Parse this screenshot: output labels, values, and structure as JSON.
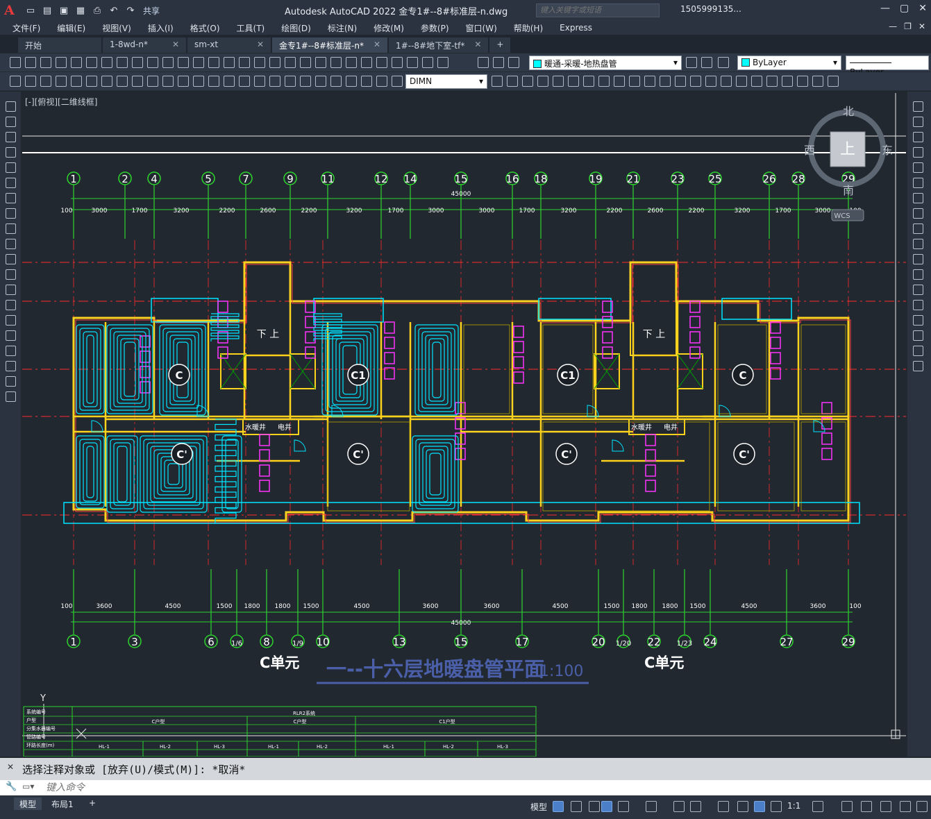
{
  "app": {
    "title": "Autodesk AutoCAD 2022    金专1#--8#标准层-n.dwg",
    "share_label": "共享",
    "search_placeholder": "键入关键字或短语",
    "user": "1505999135..."
  },
  "menu": [
    "文件(F)",
    "编辑(E)",
    "视图(V)",
    "插入(I)",
    "格式(O)",
    "工具(T)",
    "绘图(D)",
    "标注(N)",
    "修改(M)",
    "参数(P)",
    "窗口(W)",
    "帮助(H)",
    "Express"
  ],
  "tabs": [
    {
      "label": "开始"
    },
    {
      "label": "1-8wd-n*"
    },
    {
      "label": "sm-xt"
    },
    {
      "label": "金专1#--8#标准层-n*"
    },
    {
      "label": "1#--8#地下室-tf*"
    }
  ],
  "toolbar": {
    "layer": "暖通-采暖-地热盘管",
    "color": "ByLayer",
    "linetype": "ByLayer",
    "dimstyle": "DIMN"
  },
  "viewport": {
    "label": "[-][俯视][二维线框]",
    "compass": {
      "north": "北",
      "south": "南",
      "east": "东",
      "west": "西",
      "center": "上",
      "wcs": "WCS"
    }
  },
  "drawing": {
    "top_axes": [
      "1",
      "2",
      "4",
      "5",
      "7",
      "9",
      "11",
      "12",
      "14",
      "15",
      "16",
      "18",
      "19",
      "21",
      "23",
      "25",
      "26",
      "28",
      "29"
    ],
    "bottom_axes": [
      "1",
      "3",
      "6",
      "1/6",
      "8",
      "1/9",
      "10",
      "13",
      "15",
      "17",
      "20",
      "1/20",
      "22",
      "1/23",
      "24",
      "27",
      "29"
    ],
    "top_dims": [
      "100",
      "3000",
      "1700",
      "3200",
      "2200",
      "2600",
      "2200",
      "3200",
      "1700",
      "3000",
      "3000",
      "1700",
      "3200",
      "2200",
      "2600",
      "2200",
      "3200",
      "1700",
      "3000",
      "100"
    ],
    "bottom_dims": [
      "100",
      "3600",
      "4500",
      "1500",
      "1800",
      "1800",
      "1500",
      "4500",
      "3600",
      "3600",
      "4500",
      "1500",
      "1800",
      "1800",
      "1500",
      "4500",
      "3600",
      "100"
    ],
    "overall_dim": "45000",
    "unit_labels": [
      "C单元",
      "C单元"
    ],
    "title": "一--十六层地暖盘管平面",
    "scale": "1:100",
    "room_tags": [
      "C",
      "C1",
      "C1",
      "C",
      "C'",
      "C'",
      "C'",
      "C'",
      "C'",
      "C'"
    ],
    "labels": {
      "stairs": "下 上",
      "water": "水暖井",
      "elec": "电井"
    },
    "table_headers": [
      "系统编号",
      "户型",
      "分集水器编号",
      "管路编号",
      "环路长度(m)"
    ],
    "table_groups": [
      "RLR2系统",
      "C户型",
      "C户型",
      "C1户型"
    ],
    "table_loops": [
      "HL-1",
      "HL-2",
      "HL-3",
      "HL-1",
      "HL-2",
      "HL-1",
      "HL-2",
      "HL-3"
    ]
  },
  "command": {
    "history": "选择注释对象或 [放弃(U)/模式(M)]: *取消*",
    "placeholder": "键入命令"
  },
  "status": {
    "layout_tabs": [
      "模型",
      "布局1"
    ],
    "model_label": "模型",
    "scale": "1:1"
  },
  "colors": {
    "axis": "#2ed52e",
    "wall": "#ffd21e",
    "pipe": "#00e5ff",
    "grid_red": "#ff2b2b",
    "fixture": "#ff33ff"
  }
}
